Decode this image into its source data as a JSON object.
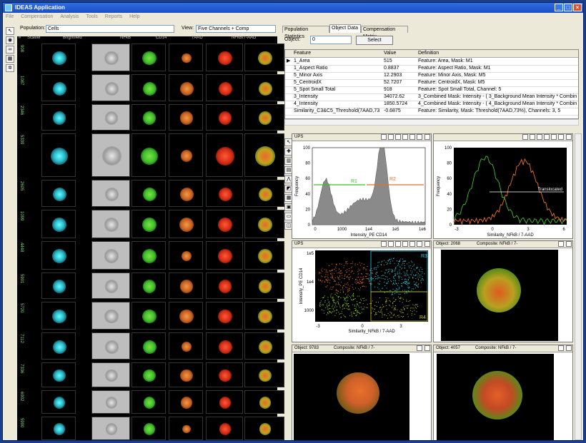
{
  "window": {
    "title": "IDEAS Application"
  },
  "menu": [
    "File",
    "Compensation",
    "Analysis",
    "Tools",
    "Reports",
    "Help"
  ],
  "gallery": {
    "population_label": "Population:",
    "population_value": "Cells",
    "view_label": "View:",
    "view_value": "Five Channels + Comp",
    "columns": [
      "#",
      "Scatter",
      "Brightfield",
      "NFkB",
      "CD14",
      "7AAD",
      "NFkB/7-AAD"
    ],
    "row_ids": [
      "908",
      "1087",
      "2346",
      "5339",
      "2605",
      "1099",
      "4448",
      "5901",
      "5720",
      "7112",
      "7336",
      "6902",
      "5990"
    ]
  },
  "tabs": [
    "Population Statistics",
    "Object Data",
    "Compensation Matrix"
  ],
  "object": {
    "label": "Object:",
    "value": "0",
    "select_label": "Select"
  },
  "table": {
    "headers": [
      "Feature",
      "Value",
      "Definition"
    ],
    "rows": [
      [
        "1_Area",
        "515",
        "Feature: Area, Mask: M1"
      ],
      [
        "1_Aspect Ratio",
        "0.8837",
        "Feature: Aspect Ratio, Mask: M1"
      ],
      [
        "5_Minor Axis",
        "12.2903",
        "Feature: Minor Axis, Mask: M5"
      ],
      [
        "5_CentroidX",
        "52.7207",
        "Feature: CentroidX, Mask: M5"
      ],
      [
        "5_Spot Small Total",
        "918",
        "Feature: Spot Small Total, Channel: 5"
      ],
      [
        "3_Intensity",
        "34072.62",
        "3_Combined Mask: Intensity - ( 3_Background Mean Intensity * Combined"
      ],
      [
        "4_Intensity",
        "1850.5724",
        "4_Combined Mask: Intensity - ( 4_Background Mean Intensity * Combined"
      ],
      [
        "Similarity_C3&C5_Threshold(7AAD,73",
        "-0.6875",
        "Feature: Similarity, Mask: Threshold(7AAD,73%), Channels: 3, 5"
      ]
    ]
  },
  "plots": {
    "hist1": {
      "title": "UPS",
      "xlabel": "Intensity_PE CD14",
      "ylabel": "Frequency",
      "xticks": [
        "0",
        "1000",
        "1e4",
        "1e5",
        "1e6"
      ],
      "yticks": [
        "0",
        "20",
        "40",
        "60",
        "80",
        "100"
      ],
      "r1": "R1",
      "r2": "R2"
    },
    "hist2": {
      "xlabel": "Similarity_NFkB / 7-AAD",
      "ylabel": "Frequency",
      "xticks": [
        "-3",
        "0",
        "3",
        "6"
      ],
      "yticks": [
        "0",
        "20",
        "40",
        "60",
        "80",
        "100"
      ],
      "gate": "Translocated"
    },
    "scatter": {
      "title": "UPS",
      "xlabel": "Similarity_NFkB / 7-AAD",
      "ylabel": "Intensity_PE CD14",
      "xticks": [
        "-3",
        "0",
        "3"
      ],
      "yticks": [
        "1000",
        "1e4",
        "1e5"
      ],
      "r3": "R3",
      "r4": "R4"
    },
    "img1": {
      "object": "Object: 2068",
      "composite": "Composite: NFkB / 7-"
    },
    "img2": {
      "object": "Object: 9783",
      "composite": "Composite: NFkB / 7-"
    },
    "img3": {
      "object": "Object: 4057",
      "composite": "Composite: NFkB / 7-"
    }
  },
  "colors": {
    "titlebar": "#1c4fc4",
    "green": "#3fbf2a",
    "orange": "#e2702a",
    "red": "#e8341a",
    "cyan": "#2fd0e0"
  }
}
